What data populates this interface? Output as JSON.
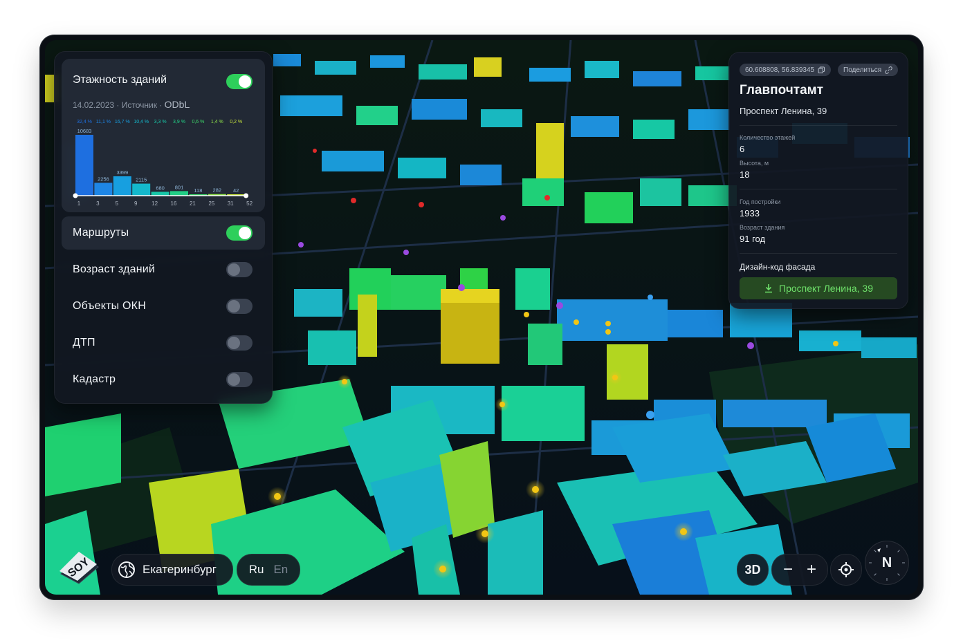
{
  "layers": {
    "floors": {
      "title": "Этажность зданий",
      "date": "14.02.2023",
      "source_label": "Источник",
      "license": "ODbL",
      "enabled": true
    },
    "items": [
      {
        "label": "Маршруты",
        "enabled": true
      },
      {
        "label": "Возраст зданий",
        "enabled": false
      },
      {
        "label": "Объекты ОКН",
        "enabled": false
      },
      {
        "label": "ДТП",
        "enabled": false
      },
      {
        "label": "Кадастр",
        "enabled": false
      }
    ]
  },
  "chart_data": {
    "type": "bar",
    "categories": [
      "1",
      "3",
      "5",
      "9",
      "12",
      "16",
      "21",
      "25",
      "31",
      "52"
    ],
    "values": [
      10683,
      2256,
      3399,
      2115,
      680,
      801,
      118,
      282,
      42
    ],
    "percent_labels": [
      "32,4 %",
      "11,1 %",
      "16,7 %",
      "10,4 %",
      "3,3 %",
      "3,9 %",
      "0,6 %",
      "1,4 %",
      "0,2 %"
    ],
    "value_labels": [
      "10683",
      "2256",
      "3399",
      "2115",
      "680",
      "801",
      "118",
      "282",
      "42"
    ],
    "colors": [
      "#1e6fe0",
      "#1e86e6",
      "#179fe0",
      "#14b8cc",
      "#18c8a8",
      "#22cf86",
      "#3ed86a",
      "#8ee04a",
      "#c8e43c"
    ],
    "xlabel": "",
    "ylabel": "",
    "ylim": [
      0,
      10683
    ]
  },
  "info": {
    "coords": "60.608808, 56.839345",
    "share_label": "Поделиться",
    "title": "Главпочтамт",
    "address": "Проспект Ленина, 39",
    "floors_label": "Количество этажей",
    "floors_value": "6",
    "height_label": "Высота, м",
    "height_value": "18",
    "year_label": "Год постройки",
    "year_value": "1933",
    "age_label": "Возраст здания",
    "age_value": "91 год",
    "facade_label": "Дизайн-код фасада",
    "facade_button": "Проспект Ленина, 39"
  },
  "controls": {
    "city": "Екатеринбург",
    "lang_ru": "Ru",
    "lang_en": "En",
    "mode_3d": "3D",
    "zoom_out": "−",
    "zoom_in": "+",
    "compass": "N"
  },
  "icons": {
    "globe": "globe-icon",
    "copy": "copy-icon",
    "link": "link-icon",
    "download": "download-icon",
    "locate": "locate-icon"
  }
}
